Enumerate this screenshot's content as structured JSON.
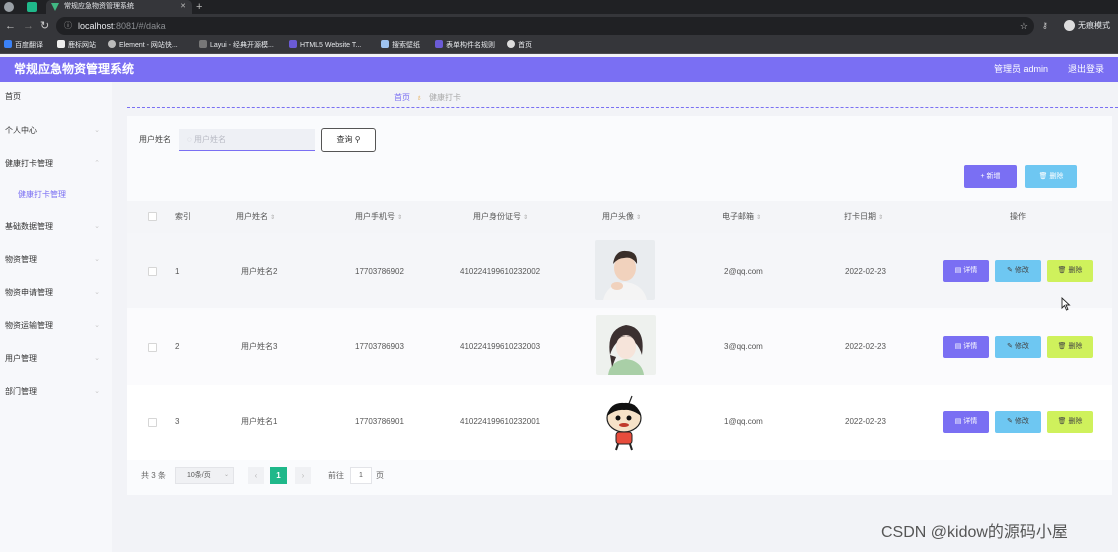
{
  "browser": {
    "tab_title": "常规应急物资管理系统",
    "url_host": "localhost",
    "url_rest": ":8081/#/daka",
    "incognito_label": "无痕模式",
    "bookmarks": [
      "百度翻译",
      "鹿标网站",
      "Element - 网站快...",
      "Layui - 经典开源模...",
      "HTML5 Website T...",
      "搜索壁纸",
      "表单构件名规则",
      "首页"
    ]
  },
  "header": {
    "title": "常规应急物资管理系统",
    "user": "管理员 admin",
    "logout": "退出登录",
    "accent_color": "#7a6ff3"
  },
  "sidebar": {
    "items": [
      "首页",
      "个人中心",
      "健康打卡管理",
      "健康打卡管理",
      "基础数据管理",
      "物资管理",
      "物资申请管理",
      "物资运输管理",
      "用户管理",
      "部门管理"
    ]
  },
  "breadcrumb": {
    "home": "首页",
    "current": "健康打卡"
  },
  "search": {
    "label": "用户姓名",
    "placeholder": "用户姓名",
    "button": "查询"
  },
  "toolbar": {
    "add": "新增",
    "delete": "删除"
  },
  "table": {
    "headers": [
      "索引",
      "用户姓名",
      "用户手机号",
      "用户身份证号",
      "用户头像",
      "电子邮箱",
      "打卡日期",
      "操作"
    ],
    "rows": [
      {
        "index": "1",
        "name": "用户姓名2",
        "phone": "17703786902",
        "id_card": "410224199610232002",
        "avatar": "avatar-young-man",
        "email": "2@qq.com",
        "date": "2022-02-23"
      },
      {
        "index": "2",
        "name": "用户姓名3",
        "phone": "17703786903",
        "id_card": "410224199610232003",
        "avatar": "avatar-illustrated-girl",
        "email": "3@qq.com",
        "date": "2022-02-23"
      },
      {
        "index": "3",
        "name": "用户姓名1",
        "phone": "17703786901",
        "id_card": "410224199610232001",
        "avatar": "avatar-cartoon-boy",
        "email": "1@qq.com",
        "date": "2022-02-23"
      }
    ],
    "row_actions": {
      "detail": "详情",
      "edit": "修改",
      "delete": "删除"
    }
  },
  "pagination": {
    "total": "共 3 条",
    "page_size": "10条/页",
    "current_page": "1",
    "goto_label": "前往",
    "goto_value": "1",
    "page_unit": "页"
  },
  "watermark": "CSDN @kidow的源码小屋"
}
